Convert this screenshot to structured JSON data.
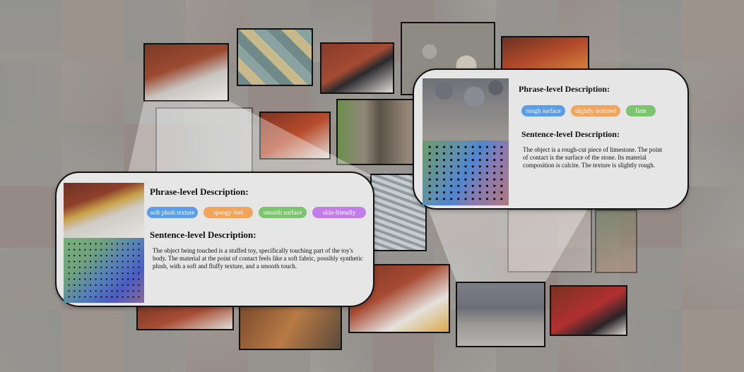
{
  "colors": {
    "tag_blue": "#5b9de6",
    "tag_orange": "#f2a35c",
    "tag_green": "#7cc46f",
    "tag_purple": "#c27ee8",
    "card_bg": "#e6e6e6",
    "frame": "#111111"
  },
  "left_card": {
    "phrase_heading": "Phrase-level Description:",
    "tags": [
      "soft plush texture",
      "spongy feel",
      "smooth surface",
      "skin-friendly"
    ],
    "sentence_heading": "Sentence-level Description:",
    "description": "The object being touched is a stuffed toy, specifically touching part of the toy's body. The material at the point of contact feels like a soft fabric, possibly synthetic plush, with a soft and fluffy texture, and a smooth touch."
  },
  "right_card": {
    "phrase_heading": "Phrase-level Description:",
    "tags": [
      "rough surface",
      "slightly textured",
      "firm"
    ],
    "sentence_heading": "Sentence-level Description:",
    "description": "The object is a rough-cut piece of limestone. The point of contact is the surface of the stone. Its material composition is calcite. The texture is slightly rough."
  }
}
